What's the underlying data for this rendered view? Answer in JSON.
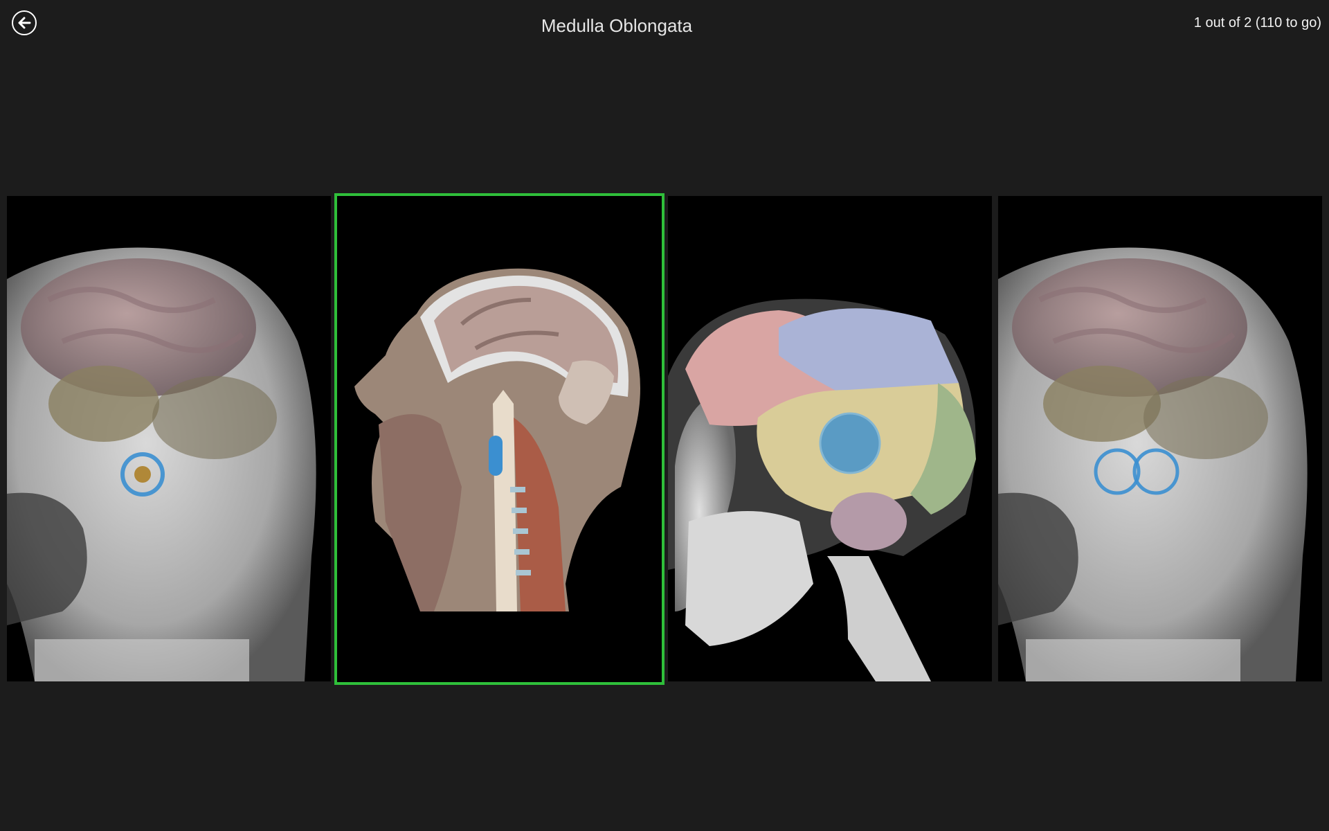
{
  "header": {
    "back_icon": "arrow-left-circle-icon",
    "title": "Medulla Oblongata",
    "progress": "1 out of 2 (110 to go)"
  },
  "colors": {
    "background": "#1c1c1c",
    "tile_background": "#000000",
    "selected_border": "#2fbf3a",
    "marker": "#3b8fd0"
  },
  "choices": [
    {
      "id": "choice-1",
      "view": "skull-transparent-brainstem-marker",
      "selected": false
    },
    {
      "id": "choice-2",
      "view": "sagittal-head-section-marker",
      "selected": true
    },
    {
      "id": "choice-3",
      "view": "brain-lobes-lateral-marker",
      "selected": false
    },
    {
      "id": "choice-4",
      "view": "skull-transparent-double-marker",
      "selected": false
    }
  ]
}
